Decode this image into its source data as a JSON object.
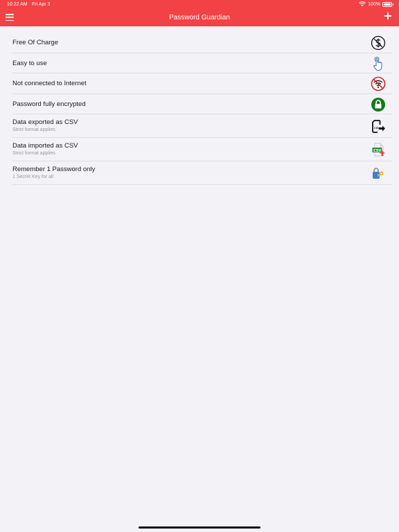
{
  "status_bar": {
    "time": "10:22 AM",
    "date": "Fri Apr 3",
    "battery": "100%"
  },
  "header": {
    "title": "Password Guardian"
  },
  "features": [
    {
      "title": "Free Of Charge",
      "subtitle": "",
      "icon": "no-dollar-icon"
    },
    {
      "title": "Easy to use",
      "subtitle": "",
      "icon": "tap-hand-icon"
    },
    {
      "title": "Not connected to Internet",
      "subtitle": "",
      "icon": "no-wifi-icon"
    },
    {
      "title": "Password fully encrypted",
      "subtitle": "",
      "icon": "lock-icon"
    },
    {
      "title": "Data exported as CSV",
      "subtitle": "Strict format applies",
      "icon": "csv-export-icon"
    },
    {
      "title": "Data imported as CSV",
      "subtitle": "Strict format applies",
      "icon": "csv-import-icon"
    },
    {
      "title": "Remember 1 Password only",
      "subtitle": "1 Secret Key for all",
      "icon": "key-lock-icon"
    }
  ],
  "colors": {
    "header": "#f24245",
    "background": "#f2f2f7",
    "divider": "#dddde2"
  },
  "csv_label": "CSV"
}
